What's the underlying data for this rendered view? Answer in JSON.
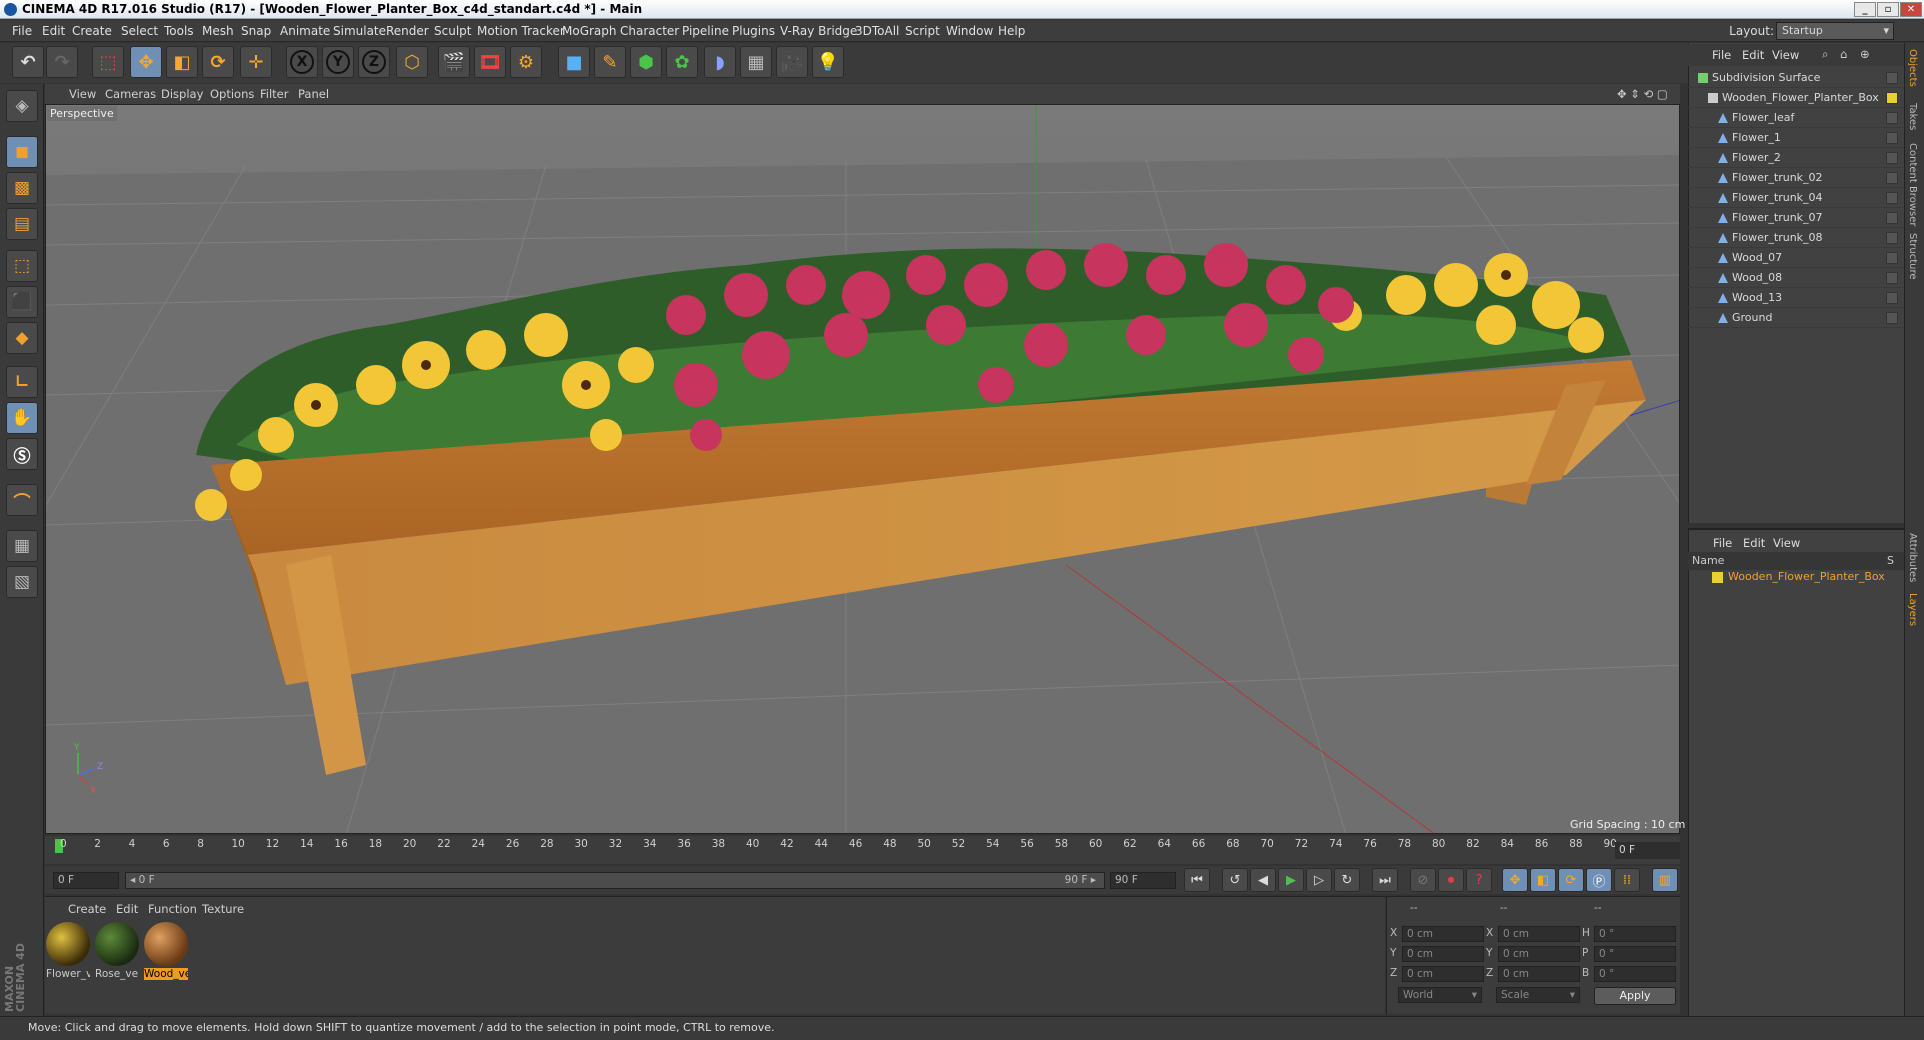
{
  "window": {
    "title": "CINEMA 4D R17.016 Studio (R17) - [Wooden_Flower_Planter_Box_c4d_standart.c4d *] - Main",
    "min": "_",
    "max": "▫",
    "close": "✕"
  },
  "menu": [
    "File",
    "Edit",
    "Create",
    "Select",
    "Tools",
    "Mesh",
    "Snap",
    "Animate",
    "Simulate",
    "Render",
    "Sculpt",
    "Motion Tracker",
    "MoGraph",
    "Character",
    "Pipeline",
    "Plugins",
    "V-Ray Bridge",
    "3DToAll",
    "Script",
    "Window",
    "Help"
  ],
  "layout": {
    "label": "Layout:",
    "value": "Startup"
  },
  "toolbar": {
    "x": "X",
    "y": "Y",
    "z": "Z"
  },
  "viewport": {
    "menu": [
      "View",
      "Cameras",
      "Display",
      "Options",
      "Filter",
      "Panel"
    ],
    "label": "Perspective",
    "grid_spacing": "Grid Spacing : 10 cm",
    "axes": {
      "y": "Y",
      "z": "Z",
      "x": "X"
    }
  },
  "timeline": {
    "ticks": [
      "0",
      "2",
      "4",
      "6",
      "8",
      "10",
      "12",
      "14",
      "16",
      "18",
      "20",
      "22",
      "24",
      "26",
      "28",
      "30",
      "32",
      "34",
      "36",
      "38",
      "40",
      "42",
      "44",
      "46",
      "48",
      "50",
      "52",
      "54",
      "56",
      "58",
      "60",
      "62",
      "64",
      "66",
      "68",
      "70",
      "72",
      "74",
      "76",
      "78",
      "80",
      "82",
      "84",
      "86",
      "88",
      "90"
    ],
    "end_frame": "0 F"
  },
  "transport": {
    "current": "0 F",
    "range_start": "◂ 0 F",
    "range_end": "90 F ▸",
    "max": "90 F"
  },
  "materials": {
    "menu": [
      "Create",
      "Edit",
      "Function",
      "Texture"
    ],
    "items": [
      {
        "name": "Flower_v",
        "color": "#5a4a10"
      },
      {
        "name": "Rose_ve",
        "color": "#2f4a1e"
      },
      {
        "name": "Wood_ve",
        "color": "#a86a35"
      }
    ],
    "brand_line1": "MAXON",
    "brand_line2": "CINEMA 4D"
  },
  "coords": {
    "headers": [
      "--",
      "--",
      "--"
    ],
    "rows": [
      {
        "a": "X",
        "av": "0 cm",
        "b": "X",
        "bv": "0 cm",
        "c": "H",
        "cv": "0 °"
      },
      {
        "a": "Y",
        "av": "0 cm",
        "b": "Y",
        "bv": "0 cm",
        "c": "P",
        "cv": "0 °"
      },
      {
        "a": "Z",
        "av": "0 cm",
        "b": "Z",
        "bv": "0 cm",
        "c": "B",
        "cv": "0 °"
      }
    ],
    "mode1": "World",
    "mode2": "Scale",
    "apply": "Apply"
  },
  "status": "Move: Click and drag to move elements. Hold down SHIFT to quantize movement / add to the selection in point mode, CTRL to remove.",
  "objects": {
    "menu": [
      "File",
      "Edit",
      "View"
    ],
    "items": [
      {
        "name": "Subdivision Surface",
        "level": 0,
        "color": "#6ed36e"
      },
      {
        "name": "Wooden_Flower_Planter_Box",
        "level": 1,
        "color": "#cccccc"
      },
      {
        "name": "Flower_leaf",
        "level": 2,
        "color": "#7fb0e8"
      },
      {
        "name": "Flower_1",
        "level": 2,
        "color": "#7fb0e8"
      },
      {
        "name": "Flower_2",
        "level": 2,
        "color": "#7fb0e8"
      },
      {
        "name": "Flower_trunk_02",
        "level": 2,
        "color": "#7fb0e8"
      },
      {
        "name": "Flower_trunk_04",
        "level": 2,
        "color": "#7fb0e8"
      },
      {
        "name": "Flower_trunk_07",
        "level": 2,
        "color": "#7fb0e8"
      },
      {
        "name": "Flower_trunk_08",
        "level": 2,
        "color": "#7fb0e8"
      },
      {
        "name": "Wood_07",
        "level": 2,
        "color": "#7fb0e8"
      },
      {
        "name": "Wood_08",
        "level": 2,
        "color": "#7fb0e8"
      },
      {
        "name": "Wood_13",
        "level": 2,
        "color": "#7fb0e8"
      },
      {
        "name": "Ground",
        "level": 2,
        "color": "#7fb0e8"
      }
    ]
  },
  "layers": {
    "menu": [
      "File",
      "Edit",
      "View"
    ],
    "col_name": "Name",
    "col_s": "S",
    "item": "Wooden_Flower_Planter_Box"
  },
  "side_tabs": [
    "Objects",
    "Takes",
    "Content Browser",
    "Structure",
    "Attributes",
    "Layers"
  ]
}
